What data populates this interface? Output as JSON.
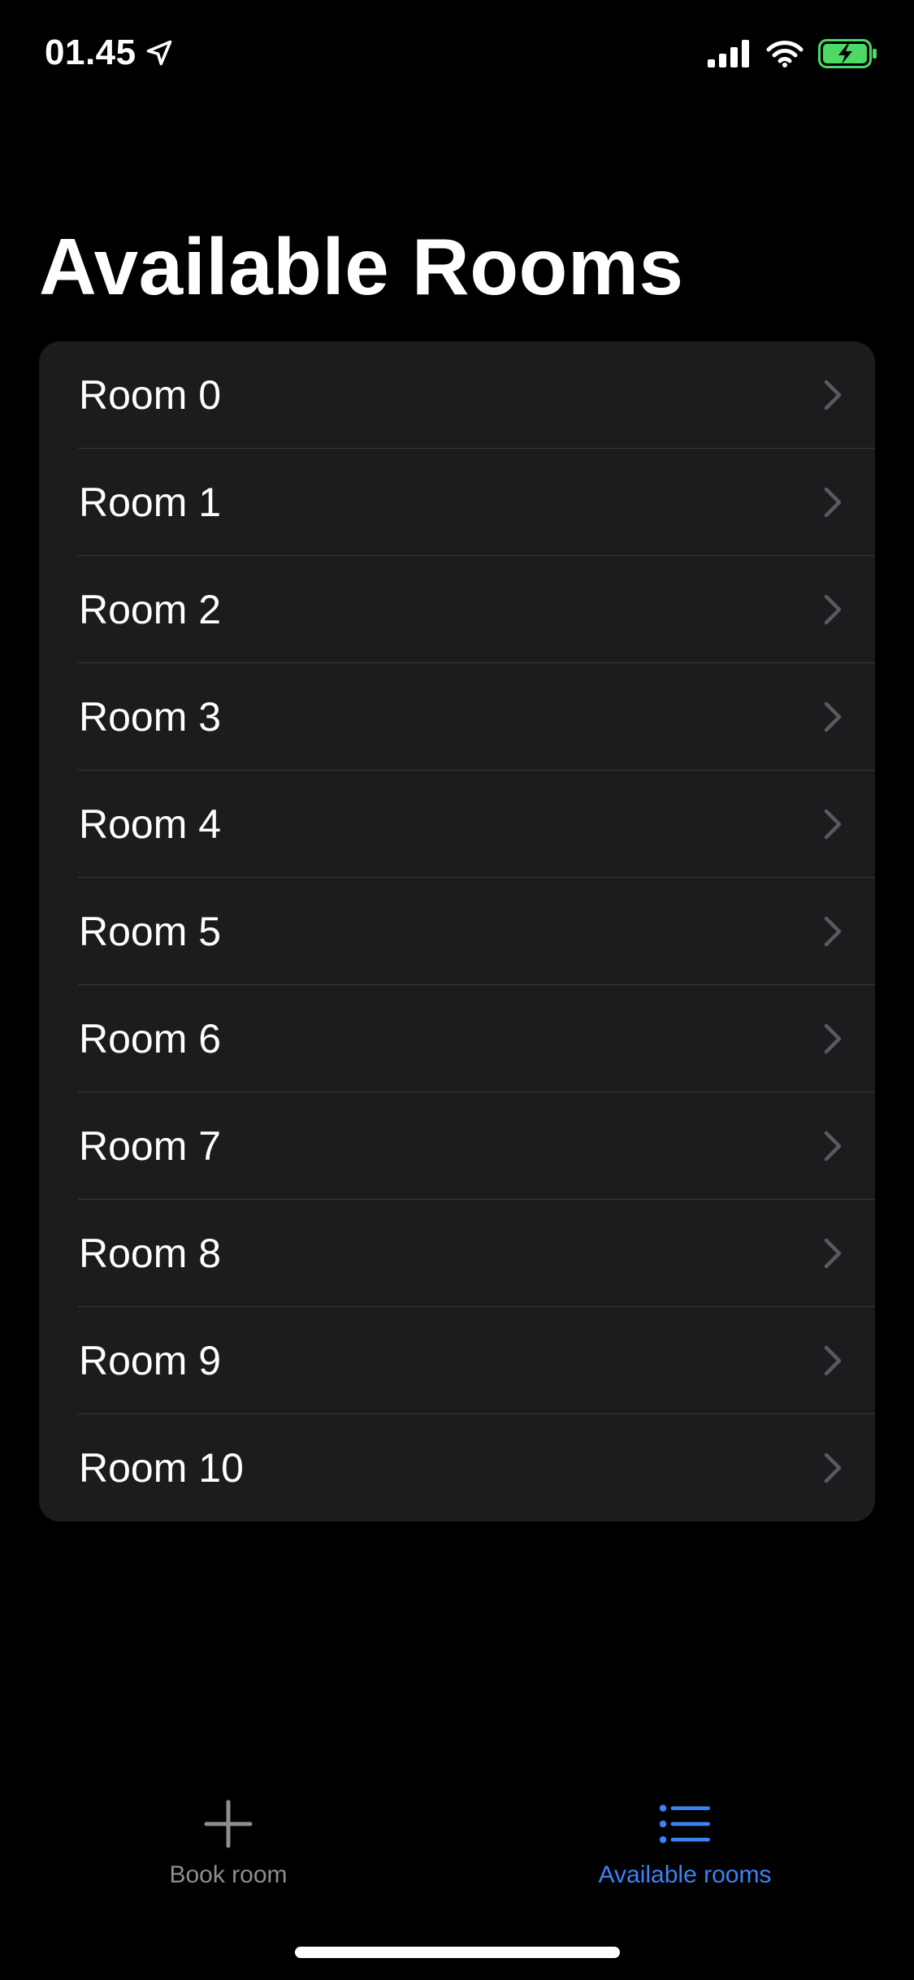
{
  "status_bar": {
    "time": "01.45",
    "icons": [
      "location-arrow-icon",
      "cellular-signal-icon",
      "wifi-icon",
      "battery-charging-icon"
    ],
    "battery_color": "#4cd964"
  },
  "page": {
    "title": "Available Rooms"
  },
  "rooms": [
    {
      "label": "Room 0"
    },
    {
      "label": "Room 1"
    },
    {
      "label": "Room 2"
    },
    {
      "label": "Room 3"
    },
    {
      "label": "Room 4"
    },
    {
      "label": "Room 5"
    },
    {
      "label": "Room 6"
    },
    {
      "label": "Room 7"
    },
    {
      "label": "Room 8"
    },
    {
      "label": "Room 9"
    },
    {
      "label": "Room 10"
    }
  ],
  "tab_bar": {
    "tabs": [
      {
        "label": "Book room",
        "icon": "plus-icon",
        "selected": false
      },
      {
        "label": "Available rooms",
        "icon": "list-icon",
        "selected": true
      }
    ],
    "accent_color": "#3a84f5",
    "inactive_color": "#8e8e93"
  }
}
